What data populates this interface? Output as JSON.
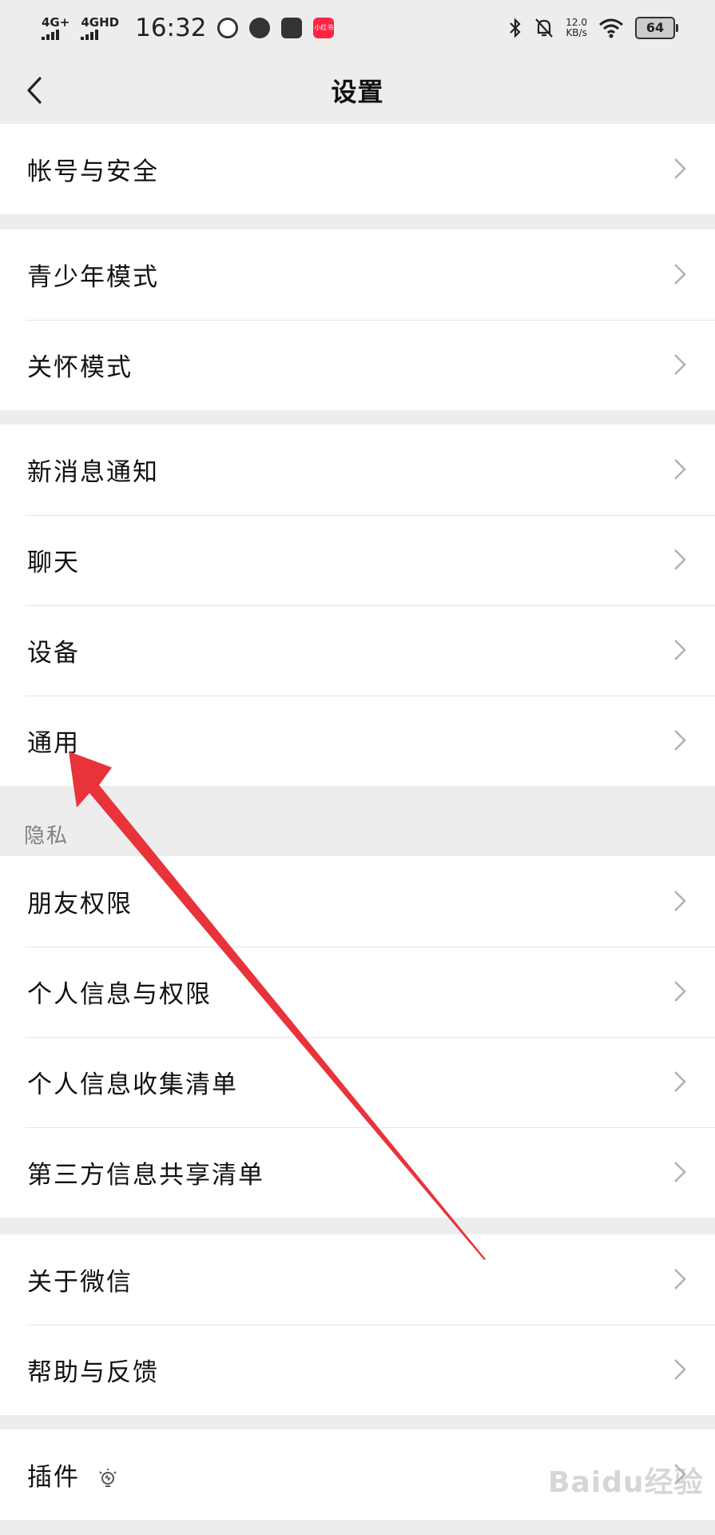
{
  "status_bar": {
    "network1": "4G+",
    "network2": "4GHD",
    "time": "16:32",
    "speed_value": "12.0",
    "speed_unit": "KB/s",
    "battery": "64",
    "app_badge": "小红书"
  },
  "nav": {
    "title": "设置"
  },
  "groups": [
    {
      "items": [
        {
          "label": "帐号与安全"
        }
      ]
    },
    {
      "items": [
        {
          "label": "青少年模式"
        },
        {
          "label": "关怀模式"
        }
      ]
    },
    {
      "items": [
        {
          "label": "新消息通知"
        },
        {
          "label": "聊天"
        },
        {
          "label": "设备"
        },
        {
          "label": "通用"
        }
      ]
    },
    {
      "section": "隐私",
      "items": [
        {
          "label": "朋友权限"
        },
        {
          "label": "个人信息与权限"
        },
        {
          "label": "个人信息收集清单"
        },
        {
          "label": "第三方信息共享清单"
        }
      ]
    },
    {
      "items": [
        {
          "label": "关于微信"
        },
        {
          "label": "帮助与反馈"
        }
      ]
    },
    {
      "items": [
        {
          "label": "插件"
        }
      ]
    }
  ],
  "annotation": {
    "color": "#e8333b"
  },
  "watermark": "Baidu经验",
  "colors": {
    "background": "#ededed",
    "card": "#ffffff",
    "divider": "#e5e5e5",
    "chevron": "#b2b2b2",
    "section_text": "#808080"
  }
}
